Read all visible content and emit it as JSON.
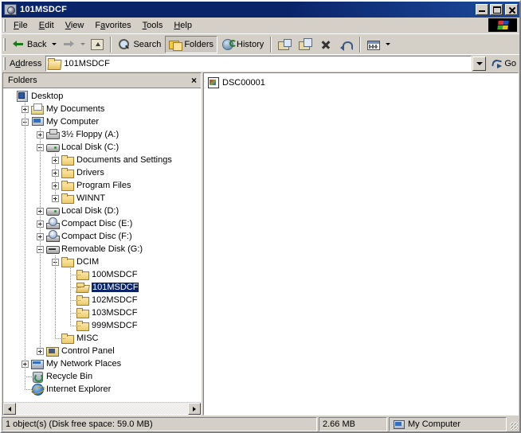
{
  "window": {
    "title": "101MSDCF",
    "icon": "camera-folder-icon",
    "minimize_label": "Minimize",
    "maximize_label": "Maximize",
    "close_label": "Close"
  },
  "menubar": {
    "items": [
      {
        "label": "File",
        "accel": "F"
      },
      {
        "label": "Edit",
        "accel": "E"
      },
      {
        "label": "View",
        "accel": "V"
      },
      {
        "label": "Favorites",
        "accel": "a"
      },
      {
        "label": "Tools",
        "accel": "T"
      },
      {
        "label": "Help",
        "accel": "H"
      }
    ],
    "logo": "windows-logo-icon"
  },
  "toolbar": {
    "back": {
      "label": "Back",
      "icon": "arrow-left-icon"
    },
    "forward": {
      "label": "",
      "icon": "arrow-right-icon"
    },
    "up": {
      "label": "",
      "icon": "up-folder-icon"
    },
    "search": {
      "label": "Search",
      "icon": "search-icon"
    },
    "folders": {
      "label": "Folders",
      "icon": "folders-icon",
      "pressed": true
    },
    "history": {
      "label": "History",
      "icon": "history-icon"
    },
    "move_to": {
      "label": "",
      "icon": "move-to-icon"
    },
    "copy_to": {
      "label": "",
      "icon": "copy-to-icon"
    },
    "delete": {
      "label": "",
      "icon": "delete-icon"
    },
    "undo": {
      "label": "",
      "icon": "undo-icon"
    },
    "views": {
      "label": "",
      "icon": "views-icon"
    }
  },
  "address": {
    "label": "Address",
    "value": "101MSDCF",
    "icon": "open-folder-icon",
    "dropdown": "chevron-down-icon",
    "go_label": "Go",
    "go_icon": "go-arrow-icon"
  },
  "folders_pane": {
    "title": "Folders",
    "close_label": "×",
    "tree": [
      {
        "label": "Desktop",
        "depth": 0,
        "expander": "none",
        "icon": "desktop-icon"
      },
      {
        "label": "My Documents",
        "depth": 1,
        "expander": "plus",
        "icon": "my-documents-icon"
      },
      {
        "label": "My Computer",
        "depth": 1,
        "expander": "minus",
        "icon": "my-computer-icon"
      },
      {
        "label": "3½ Floppy (A:)",
        "depth": 2,
        "expander": "plus",
        "icon": "floppy-drive-icon"
      },
      {
        "label": "Local Disk (C:)",
        "depth": 2,
        "expander": "minus",
        "icon": "hard-disk-icon"
      },
      {
        "label": "Documents and Settings",
        "depth": 3,
        "expander": "plus",
        "icon": "folder-icon"
      },
      {
        "label": "Drivers",
        "depth": 3,
        "expander": "plus",
        "icon": "folder-icon"
      },
      {
        "label": "Program Files",
        "depth": 3,
        "expander": "plus",
        "icon": "folder-icon"
      },
      {
        "label": "WINNT",
        "depth": 3,
        "expander": "plus",
        "icon": "folder-icon"
      },
      {
        "label": "Local Disk (D:)",
        "depth": 2,
        "expander": "plus",
        "icon": "hard-disk-icon"
      },
      {
        "label": "Compact Disc (E:)",
        "depth": 2,
        "expander": "plus",
        "icon": "cd-drive-icon"
      },
      {
        "label": "Compact Disc (F:)",
        "depth": 2,
        "expander": "plus",
        "icon": "cd-drive-icon"
      },
      {
        "label": "Removable Disk (G:)",
        "depth": 2,
        "expander": "minus",
        "icon": "removable-disk-icon"
      },
      {
        "label": "DCIM",
        "depth": 3,
        "expander": "minus",
        "icon": "folder-icon"
      },
      {
        "label": "100MSDCF",
        "depth": 4,
        "expander": "none",
        "icon": "folder-icon"
      },
      {
        "label": "101MSDCF",
        "depth": 4,
        "expander": "none",
        "icon": "open-folder-icon",
        "current": true
      },
      {
        "label": "102MSDCF",
        "depth": 4,
        "expander": "none",
        "icon": "folder-icon"
      },
      {
        "label": "103MSDCF",
        "depth": 4,
        "expander": "none",
        "icon": "folder-icon"
      },
      {
        "label": "999MSDCF",
        "depth": 4,
        "expander": "none",
        "icon": "folder-icon"
      },
      {
        "label": "MISC",
        "depth": 3,
        "expander": "none",
        "icon": "folder-icon"
      },
      {
        "label": "Control Panel",
        "depth": 2,
        "expander": "plus",
        "icon": "control-panel-icon"
      },
      {
        "label": "My Network Places",
        "depth": 1,
        "expander": "plus",
        "icon": "network-icon"
      },
      {
        "label": "Recycle Bin",
        "depth": 1,
        "expander": "none",
        "icon": "recycle-bin-icon"
      },
      {
        "label": "Internet Explorer",
        "depth": 1,
        "expander": "none",
        "icon": "internet-explorer-icon"
      }
    ]
  },
  "file_list": {
    "items": [
      {
        "label": "DSC00001",
        "icon": "image-file-icon"
      }
    ]
  },
  "statusbar": {
    "main": "1 object(s) (Disk free space: 59.0 MB)",
    "size": "2.66 MB",
    "zone": "My Computer",
    "zone_icon": "my-computer-icon"
  },
  "colors": {
    "title_active": "#0a246a",
    "face": "#d4d0c8",
    "selection": "#0a246a",
    "window": "#ffffff"
  }
}
